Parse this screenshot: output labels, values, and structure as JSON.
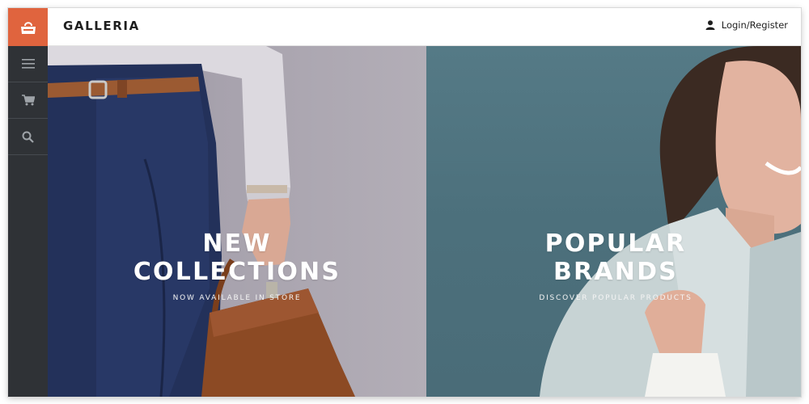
{
  "sidebar": {
    "logo_icon": "shopping-bag-icon",
    "items": [
      {
        "icon": "menu-icon",
        "label": "menu"
      },
      {
        "icon": "cart-icon",
        "label": "cart"
      },
      {
        "icon": "search-icon",
        "label": "search"
      }
    ]
  },
  "header": {
    "brand": "GALLERIA",
    "login_label": "Login/Register",
    "login_icon": "user-icon"
  },
  "hero": {
    "left": {
      "title_line1": "NEW",
      "title_line2": "COLLECTIONS",
      "subtitle": "NOW AVAILABLE IN STORE"
    },
    "right": {
      "title_line1": "POPULAR",
      "title_line2": "BRANDS",
      "subtitle": "DISCOVER POPULAR PRODUCTS"
    }
  },
  "colors": {
    "accent": "#e0643e",
    "sidebar": "#2f3236",
    "left_panel": "#a7a2ad",
    "right_panel": "#4f7380"
  }
}
